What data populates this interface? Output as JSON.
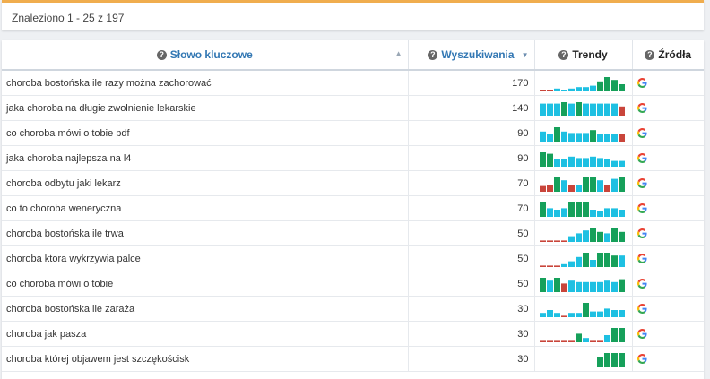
{
  "results_summary": "Znaleziono 1 - 25 z 197",
  "columns": {
    "keyword": "Słowo kluczowe",
    "searches": "Wyszukiwania",
    "trends": "Trendy",
    "sources": "Źródła"
  },
  "colors": {
    "trend_high": "#16a05a",
    "trend_mid": "#1ec0e2",
    "trend_low": "#c9453b",
    "accent_bar": "#f0ad4e",
    "header_link": "#3277b3"
  },
  "rows": [
    {
      "keyword": "choroba bostońska ile razy można zachorować",
      "searches": "170",
      "source": "google-icon",
      "trend": [
        [
          1,
          "low"
        ],
        [
          1,
          "low"
        ],
        [
          2,
          "mid"
        ],
        [
          1,
          "mid"
        ],
        [
          2,
          "mid"
        ],
        [
          3,
          "mid"
        ],
        [
          3,
          "mid"
        ],
        [
          4,
          "mid"
        ],
        [
          7,
          "high"
        ],
        [
          10,
          "high"
        ],
        [
          8,
          "high"
        ],
        [
          5,
          "high"
        ]
      ]
    },
    {
      "keyword": "jaka choroba na długie zwolnienie lekarskie",
      "searches": "140",
      "source": "google-icon",
      "trend": [
        [
          9,
          "mid"
        ],
        [
          9,
          "mid"
        ],
        [
          9,
          "mid"
        ],
        [
          10,
          "high"
        ],
        [
          9,
          "mid"
        ],
        [
          10,
          "high"
        ],
        [
          9,
          "mid"
        ],
        [
          9,
          "mid"
        ],
        [
          9,
          "mid"
        ],
        [
          9,
          "mid"
        ],
        [
          9,
          "mid"
        ],
        [
          7,
          "low"
        ]
      ]
    },
    {
      "keyword": "co choroba mówi o tobie pdf",
      "searches": "90",
      "source": "google-icon",
      "trend": [
        [
          7,
          "mid"
        ],
        [
          5,
          "mid"
        ],
        [
          10,
          "high"
        ],
        [
          7,
          "mid"
        ],
        [
          6,
          "mid"
        ],
        [
          6,
          "mid"
        ],
        [
          6,
          "mid"
        ],
        [
          8,
          "high"
        ],
        [
          5,
          "mid"
        ],
        [
          5,
          "mid"
        ],
        [
          5,
          "mid"
        ],
        [
          5,
          "low"
        ]
      ]
    },
    {
      "keyword": "jaka choroba najlepsza na l4",
      "searches": "90",
      "source": "google-icon",
      "trend": [
        [
          10,
          "high"
        ],
        [
          9,
          "high"
        ],
        [
          5,
          "mid"
        ],
        [
          5,
          "mid"
        ],
        [
          7,
          "mid"
        ],
        [
          6,
          "mid"
        ],
        [
          6,
          "mid"
        ],
        [
          7,
          "mid"
        ],
        [
          6,
          "mid"
        ],
        [
          5,
          "mid"
        ],
        [
          4,
          "mid"
        ],
        [
          4,
          "mid"
        ]
      ]
    },
    {
      "keyword": "choroba odbytu jaki lekarz",
      "searches": "70",
      "source": "google-icon",
      "trend": [
        [
          4,
          "low"
        ],
        [
          5,
          "low"
        ],
        [
          10,
          "high"
        ],
        [
          8,
          "mid"
        ],
        [
          5,
          "low"
        ],
        [
          5,
          "mid"
        ],
        [
          10,
          "high"
        ],
        [
          10,
          "high"
        ],
        [
          8,
          "mid"
        ],
        [
          5,
          "low"
        ],
        [
          9,
          "mid"
        ],
        [
          10,
          "high"
        ]
      ]
    },
    {
      "keyword": "co to choroba weneryczna",
      "searches": "70",
      "source": "google-icon",
      "trend": [
        [
          10,
          "high"
        ],
        [
          6,
          "mid"
        ],
        [
          5,
          "mid"
        ],
        [
          6,
          "mid"
        ],
        [
          10,
          "high"
        ],
        [
          10,
          "high"
        ],
        [
          10,
          "high"
        ],
        [
          5,
          "mid"
        ],
        [
          4,
          "mid"
        ],
        [
          6,
          "mid"
        ],
        [
          6,
          "mid"
        ],
        [
          5,
          "mid"
        ]
      ]
    },
    {
      "keyword": "choroba bostońska ile trwa",
      "searches": "50",
      "source": "google-icon",
      "trend": [
        [
          1,
          "low"
        ],
        [
          1,
          "low"
        ],
        [
          1,
          "low"
        ],
        [
          1,
          "low"
        ],
        [
          4,
          "mid"
        ],
        [
          6,
          "mid"
        ],
        [
          8,
          "mid"
        ],
        [
          10,
          "high"
        ],
        [
          7,
          "high"
        ],
        [
          6,
          "mid"
        ],
        [
          10,
          "high"
        ],
        [
          7,
          "high"
        ]
      ]
    },
    {
      "keyword": "choroba ktora wykrzywia palce",
      "searches": "50",
      "source": "google-icon",
      "trend": [
        [
          1,
          "low"
        ],
        [
          1,
          "low"
        ],
        [
          1,
          "low"
        ],
        [
          2,
          "mid"
        ],
        [
          4,
          "mid"
        ],
        [
          7,
          "mid"
        ],
        [
          10,
          "high"
        ],
        [
          5,
          "mid"
        ],
        [
          10,
          "high"
        ],
        [
          10,
          "high"
        ],
        [
          8,
          "high"
        ],
        [
          8,
          "mid"
        ]
      ]
    },
    {
      "keyword": "co choroba mówi o tobie",
      "searches": "50",
      "source": "google-icon",
      "trend": [
        [
          10,
          "high"
        ],
        [
          8,
          "mid"
        ],
        [
          10,
          "high"
        ],
        [
          6,
          "low"
        ],
        [
          8,
          "mid"
        ],
        [
          7,
          "mid"
        ],
        [
          7,
          "mid"
        ],
        [
          7,
          "mid"
        ],
        [
          7,
          "mid"
        ],
        [
          8,
          "mid"
        ],
        [
          7,
          "mid"
        ],
        [
          9,
          "high"
        ]
      ]
    },
    {
      "keyword": "choroba bostońska ile zaraża",
      "searches": "30",
      "source": "google-icon",
      "trend": [
        [
          3,
          "mid"
        ],
        [
          5,
          "mid"
        ],
        [
          3,
          "mid"
        ],
        [
          1,
          "low"
        ],
        [
          3,
          "mid"
        ],
        [
          3,
          "mid"
        ],
        [
          10,
          "high"
        ],
        [
          4,
          "mid"
        ],
        [
          4,
          "mid"
        ],
        [
          6,
          "mid"
        ],
        [
          5,
          "mid"
        ],
        [
          5,
          "mid"
        ]
      ]
    },
    {
      "keyword": "choroba jak pasza",
      "searches": "30",
      "source": "google-icon",
      "trend": [
        [
          1,
          "low"
        ],
        [
          1,
          "low"
        ],
        [
          1,
          "low"
        ],
        [
          1,
          "low"
        ],
        [
          1,
          "low"
        ],
        [
          6,
          "high"
        ],
        [
          3,
          "mid"
        ],
        [
          1,
          "low"
        ],
        [
          1,
          "low"
        ],
        [
          5,
          "mid"
        ],
        [
          10,
          "high"
        ],
        [
          10,
          "high"
        ]
      ]
    },
    {
      "keyword": "choroba której objawem jest szczękościsk",
      "searches": "30",
      "source": "google-icon",
      "trend": [
        [
          0,
          "none"
        ],
        [
          0,
          "none"
        ],
        [
          0,
          "none"
        ],
        [
          0,
          "none"
        ],
        [
          0,
          "none"
        ],
        [
          0,
          "none"
        ],
        [
          0,
          "none"
        ],
        [
          0,
          "none"
        ],
        [
          7,
          "high"
        ],
        [
          10,
          "high"
        ],
        [
          10,
          "high"
        ],
        [
          10,
          "high"
        ]
      ]
    }
  ]
}
